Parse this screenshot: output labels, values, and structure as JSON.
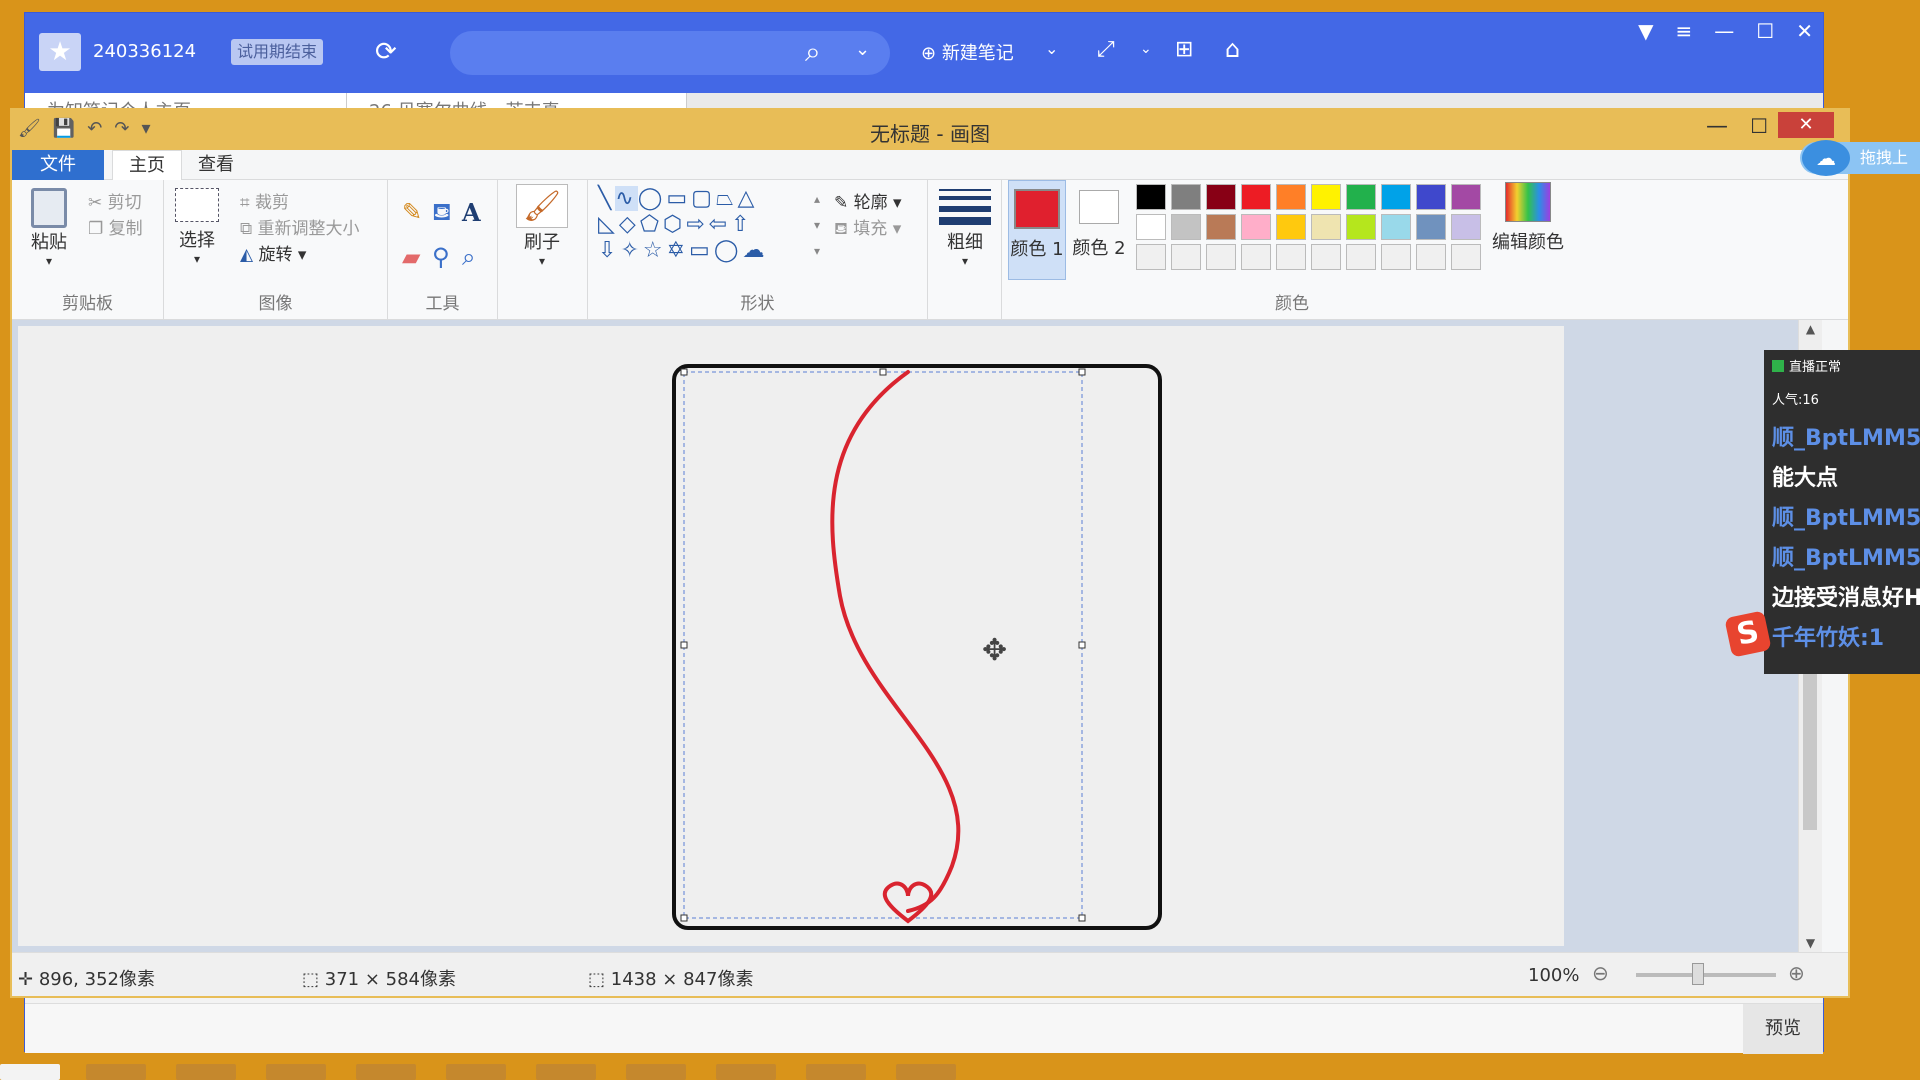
{
  "note_app": {
    "user_id": "240336124",
    "trial_label": "试用期结束",
    "new_note_label": "新建笔记",
    "tabs": [
      "为知笔记个人主页",
      "26 贝塞尔曲线 - 芒丰真"
    ],
    "preview_label": "预览"
  },
  "paint": {
    "title": "无标题 - 画图",
    "ribbon_tabs": {
      "file": "文件",
      "home": "主页",
      "view": "查看"
    },
    "clipboard": {
      "paste": "粘贴",
      "cut": "剪切",
      "copy": "复制",
      "label": "剪贴板"
    },
    "image": {
      "select": "选择",
      "crop": "裁剪",
      "resize": "重新调整大小",
      "rotate": "旋转",
      "label": "图像"
    },
    "tools": {
      "label": "工具"
    },
    "brush": {
      "label": "刷子"
    },
    "shapes": {
      "label": "形状",
      "outline": "轮廓",
      "fill": "填充"
    },
    "size": {
      "label": "粗细"
    },
    "colors": {
      "color1_label": "颜色 1",
      "color2_label": "颜色 2",
      "edit_label": "编辑颜色",
      "group_label": "颜色",
      "color1": "#e0202e",
      "color2": "#ffffff",
      "palette_row1": [
        "#000000",
        "#7f7f7f",
        "#880015",
        "#ed1c24",
        "#ff7f27",
        "#fff200",
        "#22b14c",
        "#00a2e8",
        "#3f48cc",
        "#a349a4"
      ],
      "palette_row2": [
        "#ffffff",
        "#c3c3c3",
        "#b97a57",
        "#ffaec9",
        "#ffc90e",
        "#efe4b0",
        "#b5e61d",
        "#99d9ea",
        "#7092be",
        "#c8bfe7"
      ]
    },
    "status": {
      "cursor_pos": "896, 352像素",
      "selection_size": "371 × 584像素",
      "canvas_size": "1438 × 847像素",
      "zoom": "100%"
    },
    "drawing": {
      "stroke_color": "#d9242f"
    }
  },
  "chat": {
    "status": "直播正常",
    "popularity": "人气:16",
    "messages": [
      {
        "type": "name",
        "text": "顺_BptLMM5"
      },
      {
        "type": "msg",
        "text": "能大点"
      },
      {
        "type": "name",
        "text": "顺_BptLMM5"
      },
      {
        "type": "name",
        "text": "顺_BptLMM5"
      },
      {
        "type": "msg",
        "text": "边接受消息好H"
      },
      {
        "type": "name",
        "text": "千年竹妖:1"
      }
    ]
  },
  "baidu": {
    "label": "拖拽上"
  }
}
